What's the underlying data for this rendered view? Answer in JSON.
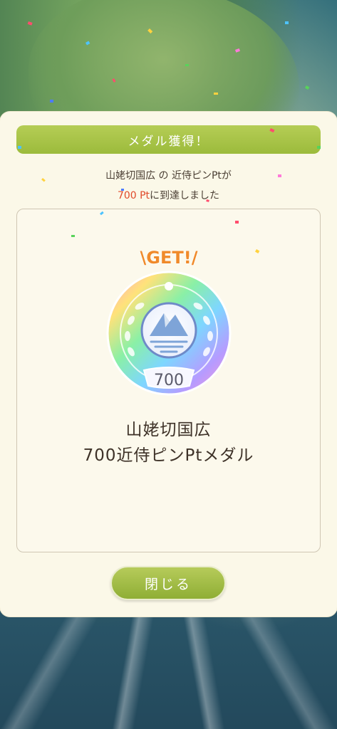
{
  "dialog": {
    "title": "メダル獲得！",
    "message": {
      "place": "山姥切国広",
      "particle": "の",
      "category": "近侍ピンPt",
      "suffix1": "が",
      "value": "700 Pt",
      "suffix2": "に到達しました"
    },
    "get_badge": "\\GET!/",
    "medal": {
      "number": "700",
      "name_line1": "山姥切国広",
      "name_line2": "700近侍ピンPtメダル"
    },
    "close_label": "閉じる"
  },
  "colors": {
    "header_green": "#a3c044",
    "button_green": "#9ab83e",
    "highlight_red": "#e04a2a",
    "get_orange": "#f08a2a",
    "panel_bg": "#fbf8e8"
  }
}
